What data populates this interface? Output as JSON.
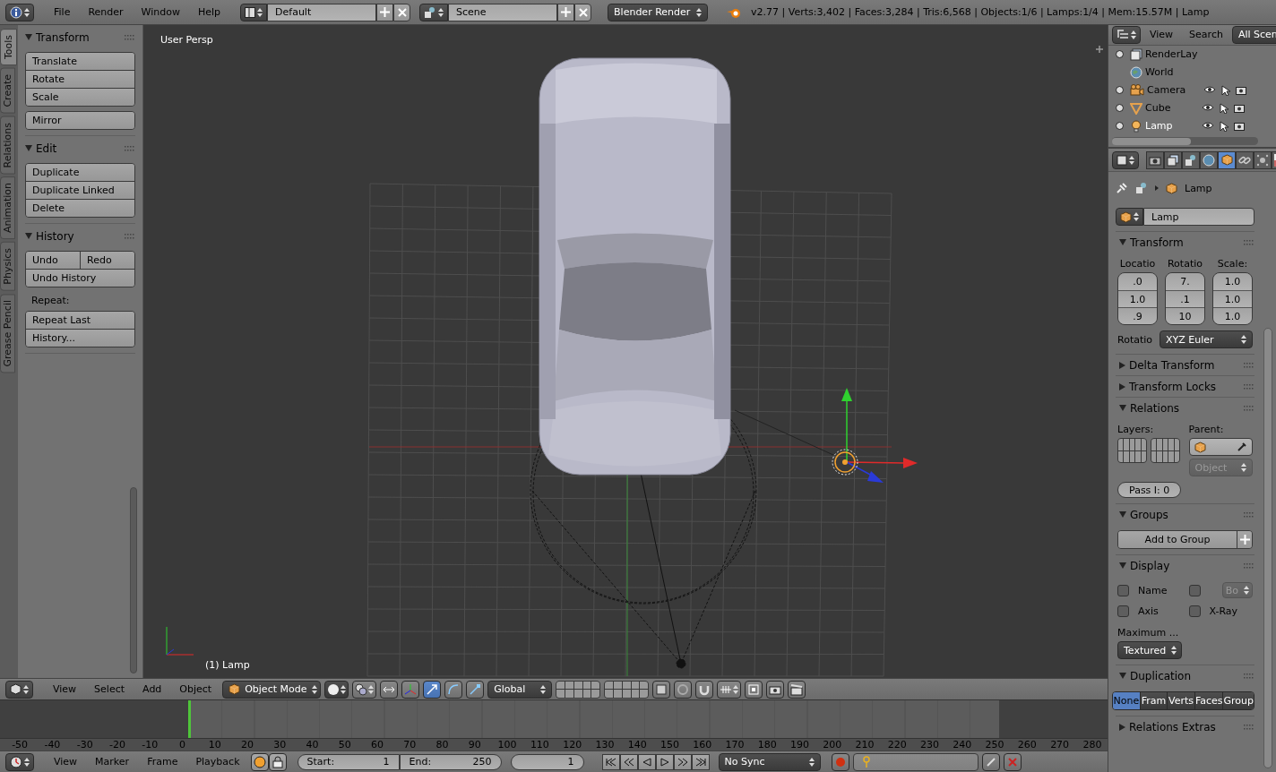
{
  "top_bar": {
    "menus": [
      "File",
      "Render",
      "Window",
      "Help"
    ],
    "layout": "Default",
    "scene": "Scene",
    "engine": "Blender Render",
    "stats": "v2.77 | Verts:3,402 | Faces:3,284 | Tris:6,568 | Objects:1/6 | Lamps:1/4 | Mem:15.57M | Lamp"
  },
  "tool_tabs": [
    {
      "label": "Tools",
      "selected": true
    },
    {
      "label": "Create",
      "selected": false
    },
    {
      "label": "Relations",
      "selected": false
    },
    {
      "label": "Animation",
      "selected": false
    },
    {
      "label": "Physics",
      "selected": false
    },
    {
      "label": "Grease Pencil",
      "selected": false
    }
  ],
  "tool_panels": [
    {
      "title": "Transform",
      "expanded": true,
      "groups": [
        {
          "kind": "buttons",
          "rows": [
            [
              "Translate"
            ],
            [
              "Rotate"
            ],
            [
              "Scale"
            ]
          ]
        },
        {
          "kind": "buttons",
          "rows": [
            [
              "Mirror"
            ]
          ]
        }
      ]
    },
    {
      "title": "Edit",
      "expanded": true,
      "groups": [
        {
          "kind": "buttons",
          "rows": [
            [
              "Duplicate"
            ],
            [
              "Duplicate Linked"
            ],
            [
              "Delete"
            ]
          ]
        }
      ]
    },
    {
      "title": "History",
      "expanded": true,
      "groups": [
        {
          "kind": "buttons",
          "rows": [
            [
              "Undo",
              "Redo"
            ],
            [
              "Undo History"
            ]
          ]
        },
        {
          "kind": "label",
          "text": "Repeat:"
        },
        {
          "kind": "buttons",
          "rows": [
            [
              "Repeat Last"
            ],
            [
              "History..."
            ]
          ]
        }
      ]
    }
  ],
  "viewport": {
    "view_label": "User Persp",
    "object_label": "(1) Lamp"
  },
  "viewport_header": {
    "menus": [
      "View",
      "Select",
      "Add",
      "Object"
    ],
    "mode": "Object Mode",
    "orientation": "Global"
  },
  "timeline": {
    "ruler": [
      "-50",
      "-40",
      "-30",
      "-20",
      "-10",
      "0",
      "10",
      "20",
      "30",
      "40",
      "50",
      "60",
      "70",
      "80",
      "90",
      "100",
      "110",
      "120",
      "130",
      "140",
      "150",
      "160",
      "170",
      "180",
      "190",
      "200",
      "210",
      "220",
      "230",
      "240",
      "250",
      "260",
      "270",
      "280"
    ]
  },
  "timeline_header": {
    "menus": [
      "View",
      "Marker",
      "Frame",
      "Playback"
    ],
    "start_label": "Start:",
    "start": "1",
    "end_label": "End:",
    "end": "250",
    "current": "1",
    "sync": "No Sync"
  },
  "outliner": {
    "menus": [
      "View",
      "Search"
    ],
    "filter": "All Scen",
    "items": [
      {
        "name": "RenderLay",
        "kind": "renderlayer",
        "expandable": true,
        "selected": false
      },
      {
        "name": "World",
        "kind": "world",
        "expandable": false,
        "selected": false
      },
      {
        "name": "Camera",
        "kind": "camera",
        "expandable": true,
        "selected": false
      },
      {
        "name": "Cube",
        "kind": "mesh",
        "expandable": true,
        "selected": false
      },
      {
        "name": "Lamp",
        "kind": "lamp",
        "expandable": true,
        "selected": true
      }
    ]
  },
  "properties": {
    "tabs": [
      {
        "kind": "render",
        "selected": false
      },
      {
        "kind": "layers",
        "selected": false
      },
      {
        "kind": "scene",
        "selected": false
      },
      {
        "kind": "world",
        "selected": false
      },
      {
        "kind": "object",
        "selected": true
      },
      {
        "kind": "constraints",
        "selected": false
      },
      {
        "kind": "particles",
        "selected": false
      },
      {
        "kind": "texture",
        "selected": false
      }
    ],
    "breadcrumb": "Lamp",
    "object_name": "Lamp",
    "panels": [
      {
        "kind": "transform",
        "title": "Transform",
        "expanded": true,
        "columns": [
          {
            "label": "Locatio",
            "values": [
              ".0",
              "1.0",
              ".9"
            ]
          },
          {
            "label": "Rotatio",
            "values": [
              "7.",
              ".1",
              "10"
            ]
          },
          {
            "label": "Scale:",
            "values": [
              "1.0",
              "1.0",
              "1.0"
            ]
          }
        ],
        "mode_label": "Rotatio",
        "mode": "XYZ Euler"
      },
      {
        "kind": "plain",
        "title": "Delta Transform",
        "expanded": false
      },
      {
        "kind": "plain",
        "title": "Transform Locks",
        "expanded": false
      },
      {
        "kind": "relations",
        "title": "Relations",
        "expanded": true,
        "layers_label": "Layers:",
        "parent_label": "Parent:",
        "parent_type": "Object",
        "pass_index": "Pass I: 0"
      },
      {
        "kind": "groups",
        "title": "Groups",
        "expanded": true,
        "button": "Add to Group"
      },
      {
        "kind": "display",
        "title": "Display",
        "expanded": true,
        "name": {
          "label": "Name",
          "checked": false
        },
        "axis": {
          "label": "Axis",
          "checked": false
        },
        "bounds": {
          "checked": false,
          "type": "Bo"
        },
        "xray": {
          "label": "X-Ray",
          "checked": false
        },
        "max_label": "Maximum ...",
        "max_draw": "Textured"
      },
      {
        "kind": "duplication",
        "title": "Duplication",
        "expanded": true,
        "options": [
          {
            "label": "None",
            "selected": true
          },
          {
            "label": "Fram",
            "selected": false
          },
          {
            "label": "Verts",
            "selected": false
          },
          {
            "label": "Faces",
            "selected": false
          },
          {
            "label": "Group",
            "selected": false
          }
        ]
      },
      {
        "kind": "plain",
        "title": "Relations Extras",
        "expanded": false
      }
    ]
  }
}
